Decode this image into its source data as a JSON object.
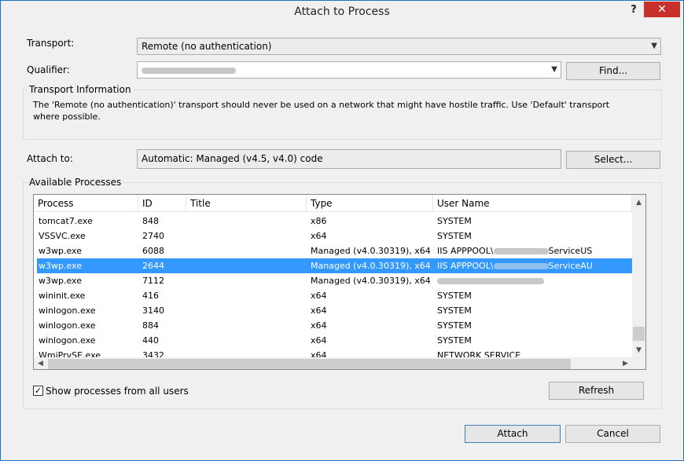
{
  "window": {
    "title": "Attach to Process",
    "help_label": "?",
    "close_label": "✕"
  },
  "transport": {
    "label": "Transport:",
    "value": "Remote (no authentication)"
  },
  "qualifier": {
    "label": "Qualifier:",
    "find_button": "Find..."
  },
  "transport_info": {
    "title": "Transport Information",
    "text": "The 'Remote (no authentication)' transport should never be used on a network that might have hostile traffic. Use 'Default' transport where possible."
  },
  "attach_to": {
    "label": "Attach to:",
    "value": "Automatic: Managed (v4.5, v4.0) code",
    "select_button": "Select..."
  },
  "processes": {
    "title": "Available Processes",
    "columns": [
      "Process",
      "ID",
      "Title",
      "Type",
      "User Name"
    ],
    "rows": [
      {
        "process": "tomcat7.exe",
        "id": "848",
        "title": "",
        "type": "x86",
        "user": "SYSTEM"
      },
      {
        "process": "VSSVC.exe",
        "id": "2740",
        "title": "",
        "type": "x64",
        "user": "SYSTEM"
      },
      {
        "process": "w3wp.exe",
        "id": "6088",
        "title": "",
        "type": "Managed (v4.0.30319), x64",
        "user": "IIS APPPOOL\\",
        "user_suffix": "ServiceUS"
      },
      {
        "process": "w3wp.exe",
        "id": "2644",
        "title": "",
        "type": "Managed (v4.0.30319), x64",
        "user": "IIS APPPOOL\\",
        "user_suffix": "ServiceAU"
      },
      {
        "process": "w3wp.exe",
        "id": "7112",
        "title": "",
        "type": "Managed (v4.0.30319), x64",
        "user": "",
        "user_suffix": ""
      },
      {
        "process": "wininit.exe",
        "id": "416",
        "title": "",
        "type": "x64",
        "user": "SYSTEM"
      },
      {
        "process": "winlogon.exe",
        "id": "3140",
        "title": "",
        "type": "x64",
        "user": "SYSTEM"
      },
      {
        "process": "winlogon.exe",
        "id": "884",
        "title": "",
        "type": "x64",
        "user": "SYSTEM"
      },
      {
        "process": "winlogon.exe",
        "id": "440",
        "title": "",
        "type": "x64",
        "user": "SYSTEM"
      },
      {
        "process": "WmiPrvSE.exe",
        "id": "3432",
        "title": "",
        "type": "x64",
        "user": "NETWORK SERVICE"
      }
    ],
    "selected_index": 3,
    "show_all_label": "Show processes from all users",
    "show_all_checked": true,
    "refresh_button": "Refresh"
  },
  "footer": {
    "attach_button": "Attach",
    "cancel_button": "Cancel"
  },
  "colors": {
    "selection": "#3399ff",
    "close": "#c7302b",
    "window_bg": "#f0f0f0"
  }
}
